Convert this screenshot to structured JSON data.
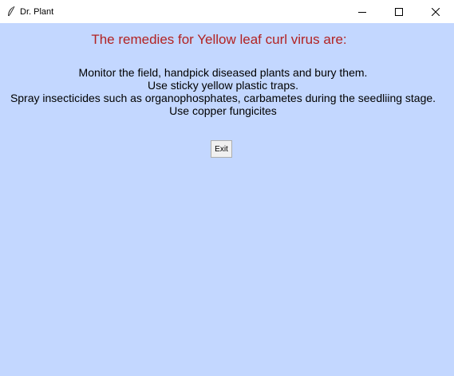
{
  "window": {
    "title": "Dr. Plant",
    "icon": "feather-icon",
    "controls": [
      "minimize-icon",
      "maximize-icon",
      "close-icon"
    ]
  },
  "heading": "The remedies for Yellow leaf curl virus are:",
  "remedies": [
    "Monitor the field, handpick diseased plants and bury them.",
    "Use sticky yellow plastic traps.",
    "Spray insecticides such as organophosphates, carbametes during the seedliing stage.",
    "Use copper fungicites"
  ],
  "buttons": {
    "exit_label": "Exit"
  },
  "colors": {
    "background": "#c3d7ff",
    "heading": "#b22222"
  }
}
